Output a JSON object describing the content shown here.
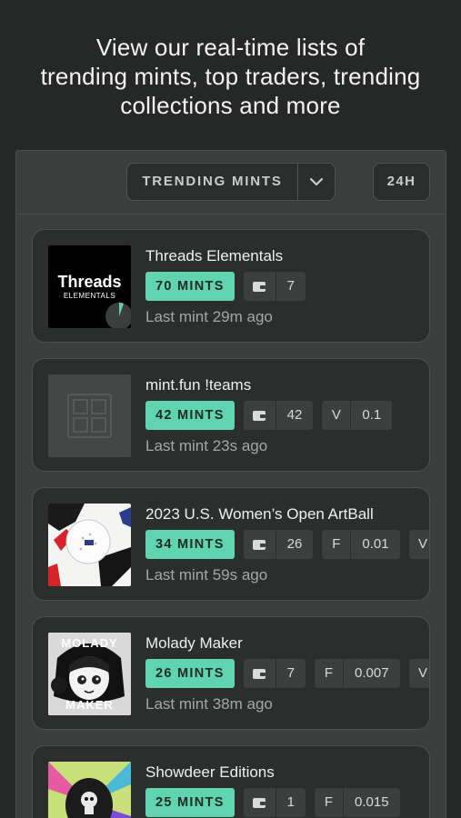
{
  "headline": {
    "line1": "View our real-time lists of",
    "line2": "trending mints, top traders, trending",
    "line3": "collections and  more"
  },
  "toolbar": {
    "dropdown_label": "TRENDING MINTS",
    "dropdown_icon": "chevron-down-icon",
    "period_label": "24H"
  },
  "collections": [
    {
      "title": "Threads Elementals",
      "mints": "70 MINTS",
      "wallet_count": "7",
      "last_mint": "Last mint 29m ago",
      "thumb_text_main": "Threads",
      "thumb_text_sub": "ELEMENTALS"
    },
    {
      "title": "mint.fun !teams",
      "mints": "42 MINTS",
      "wallet_count": "42",
      "extra_key": "V",
      "extra_val": "0.1",
      "last_mint": "Last mint 23s ago"
    },
    {
      "title": "2023 U.S. Women’s Open ArtBall",
      "mints": "34 MINTS",
      "wallet_count": "26",
      "extra_key": "F",
      "extra_val": "0.01",
      "clipped_key": "V",
      "last_mint": "Last mint 59s ago"
    },
    {
      "title": "Molady Maker",
      "mints": "26 MINTS",
      "wallet_count": "7",
      "extra_key": "F",
      "extra_val": "0.007",
      "clipped_key": "V",
      "last_mint": "Last mint 38m ago",
      "thumb_text_top": "MOLADY",
      "thumb_text_bottom": "MAKER"
    },
    {
      "title": "Showdeer Editions",
      "mints": "25 MINTS",
      "wallet_count": "1",
      "extra_key": "F",
      "extra_val": "0.015"
    }
  ],
  "colors": {
    "accent": "#5fd4ae",
    "background": "#262827",
    "panel": "#3a3e3c",
    "card": "#2b2e2d"
  }
}
